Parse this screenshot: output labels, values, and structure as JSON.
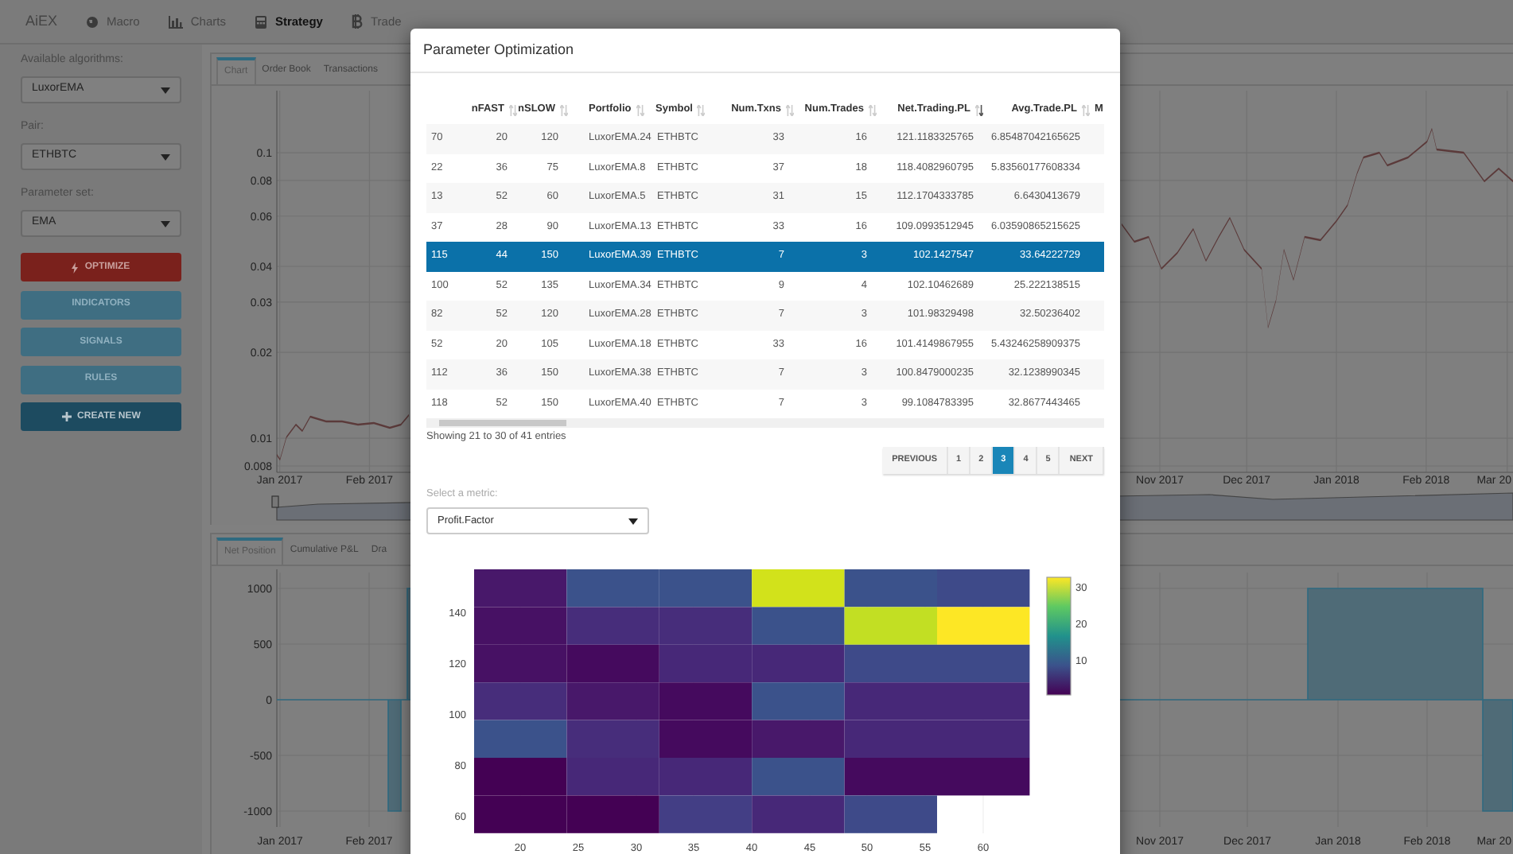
{
  "nav": {
    "brand": "AiEX",
    "items": [
      {
        "label": "Macro",
        "selected": false
      },
      {
        "label": "Charts",
        "selected": false
      },
      {
        "label": "Strategy",
        "selected": true
      },
      {
        "label": "Trade",
        "selected": false
      }
    ]
  },
  "sidebar": {
    "fields": [
      {
        "label": "Available algorithms:",
        "value": "LuxorEMA"
      },
      {
        "label": "Pair:",
        "value": "ETHBTC"
      },
      {
        "label": "Parameter set:",
        "value": "EMA"
      }
    ],
    "buttons": [
      {
        "label": "OPTIMIZE",
        "kind": "danger"
      },
      {
        "label": "INDICATORS",
        "kind": "info"
      },
      {
        "label": "SIGNALS",
        "kind": "info"
      },
      {
        "label": "RULES",
        "kind": "info"
      },
      {
        "label": "CREATE NEW",
        "kind": "primary"
      }
    ]
  },
  "price_panel": {
    "tabs": [
      {
        "label": "Chart",
        "selected": true
      },
      {
        "label": "Order Book",
        "selected": false
      },
      {
        "label": "Transactions",
        "selected": false
      }
    ],
    "yticks": [
      "0.1",
      "0.08",
      "0.06",
      "0.04",
      "0.03",
      "0.02",
      "0.01",
      "0.008"
    ],
    "xticks": [
      "Jan 2017",
      "Feb 2017",
      "Nov 2017",
      "Dec 2017",
      "Jan 2018",
      "Feb 2018",
      "Mar 20"
    ]
  },
  "position_panel": {
    "tabs": [
      {
        "label": "Net Position",
        "selected": true
      },
      {
        "label": "Cumulative P&L",
        "selected": false
      },
      {
        "label": "Dra",
        "selected": false
      }
    ],
    "yticks": [
      "1000",
      "500",
      "0",
      "-500",
      "-1000"
    ],
    "xticks_left": [
      "Jan 2017",
      "Feb 2017"
    ],
    "xticks_right": [
      "Nov 2017",
      "Dec 2017",
      "Jan 2018",
      "Feb 2018",
      "Mar 20"
    ]
  },
  "modal": {
    "title": "Parameter Optimization",
    "table": {
      "columns": [
        {},
        {
          "label": "nFAST",
          "sorted": false
        },
        {
          "label": "nSLOW",
          "sorted": false
        },
        {
          "label": "Portfolio",
          "sorted": false
        },
        {
          "label": "Symbol",
          "sorted": false
        },
        {
          "label": "Num.Txns",
          "sorted": false
        },
        {
          "label": "Num.Trades",
          "sorted": false
        },
        {
          "label": "Net.Trading.PL",
          "sorted": true
        },
        {
          "label": "Avg.Trade.PL",
          "sorted": false
        },
        {
          "label": "M"
        }
      ],
      "rows": [
        {
          "cells": [
            "70",
            "20",
            "120",
            "LuxorEMA.24",
            "ETHBTC",
            "33",
            "16",
            "121.1183325765",
            "6.85487042165625"
          ],
          "selected": false
        },
        {
          "cells": [
            "22",
            "36",
            "75",
            "LuxorEMA.8",
            "ETHBTC",
            "37",
            "18",
            "118.4082960795",
            "5.83560177608334"
          ],
          "selected": false
        },
        {
          "cells": [
            "13",
            "52",
            "60",
            "LuxorEMA.5",
            "ETHBTC",
            "31",
            "15",
            "112.1704333785",
            "6.6430413679"
          ],
          "selected": false
        },
        {
          "cells": [
            "37",
            "28",
            "90",
            "LuxorEMA.13",
            "ETHBTC",
            "33",
            "16",
            "109.0993512945",
            "6.03590865215625"
          ],
          "selected": false
        },
        {
          "cells": [
            "115",
            "44",
            "150",
            "LuxorEMA.39",
            "ETHBTC",
            "7",
            "3",
            "102.1427547",
            "33.64222729"
          ],
          "selected": true
        },
        {
          "cells": [
            "100",
            "52",
            "135",
            "LuxorEMA.34",
            "ETHBTC",
            "9",
            "4",
            "102.10462689",
            "25.222138515"
          ],
          "selected": false
        },
        {
          "cells": [
            "82",
            "52",
            "120",
            "LuxorEMA.28",
            "ETHBTC",
            "7",
            "3",
            "101.98329498",
            "32.50236402"
          ],
          "selected": false
        },
        {
          "cells": [
            "52",
            "20",
            "105",
            "LuxorEMA.18",
            "ETHBTC",
            "33",
            "16",
            "101.4149867955",
            "5.43246258909375"
          ],
          "selected": false
        },
        {
          "cells": [
            "112",
            "36",
            "150",
            "LuxorEMA.38",
            "ETHBTC",
            "7",
            "3",
            "100.8479000235",
            "32.1238990345"
          ],
          "selected": false
        },
        {
          "cells": [
            "118",
            "52",
            "150",
            "LuxorEMA.40",
            "ETHBTC",
            "7",
            "3",
            "99.1084783395",
            "32.8677443465"
          ],
          "selected": false
        }
      ]
    },
    "info": "Showing 21 to 30 of 41 entries",
    "pagination": [
      {
        "label": "PREVIOUS",
        "selected": false
      },
      {
        "label": "1",
        "selected": false
      },
      {
        "label": "2",
        "selected": false
      },
      {
        "label": "3",
        "selected": true
      },
      {
        "label": "4",
        "selected": false
      },
      {
        "label": "5",
        "selected": false
      },
      {
        "label": "NEXT",
        "selected": false
      }
    ],
    "metric_label": "Select a metric:",
    "metric_value": "Profit.Factor",
    "heatmap": {
      "rows": [
        {
          "cells": [
            {
              "color": "#48186a"
            },
            {
              "color": "#3b528b"
            },
            {
              "color": "#3b528b"
            },
            {
              "color": "#d2e21b"
            },
            {
              "color": "#3b528b"
            },
            {
              "color": "#3e4a89"
            }
          ]
        },
        {
          "cells": [
            {
              "color": "#471164"
            },
            {
              "color": "#472d7b"
            },
            {
              "color": "#472d7b"
            },
            {
              "color": "#3b528b"
            },
            {
              "color": "#c2df23"
            },
            {
              "color": "#fde725"
            }
          ]
        },
        {
          "cells": [
            {
              "color": "#471164"
            },
            {
              "color": "#450a5e"
            },
            {
              "color": "#472878"
            },
            {
              "color": "#472878"
            },
            {
              "color": "#3e4a89"
            },
            {
              "color": "#3e4a89"
            }
          ]
        },
        {
          "cells": [
            {
              "color": "#472d7b"
            },
            {
              "color": "#48186a"
            },
            {
              "color": "#450a5e"
            },
            {
              "color": "#3b528b"
            },
            {
              "color": "#472878"
            },
            {
              "color": "#472878"
            }
          ]
        },
        {
          "cells": [
            {
              "color": "#3b528b"
            },
            {
              "color": "#472d7b"
            },
            {
              "color": "#450a5e"
            },
            {
              "color": "#48186a"
            },
            {
              "color": "#472878"
            },
            {
              "color": "#472878"
            }
          ]
        },
        {
          "cells": [
            {
              "color": "#440154"
            },
            {
              "color": "#472878"
            },
            {
              "color": "#472878"
            },
            {
              "color": "#3b528b"
            },
            {
              "color": "#450a5e"
            },
            {
              "color": "#450a5e"
            }
          ]
        },
        {
          "cells": [
            {
              "color": "#440154"
            },
            {
              "color": "#440154"
            },
            {
              "color": "#433e85"
            },
            {
              "color": "#472878"
            },
            {
              "color": "#3e4a89"
            }
          ]
        }
      ],
      "xticks": [
        "20",
        "25",
        "30",
        "35",
        "40",
        "45",
        "50",
        "55",
        "60"
      ],
      "yticks": [
        "140",
        "120",
        "100",
        "80",
        "60"
      ],
      "colorbar_ticks": [
        "30",
        "20",
        "10"
      ]
    }
  }
}
